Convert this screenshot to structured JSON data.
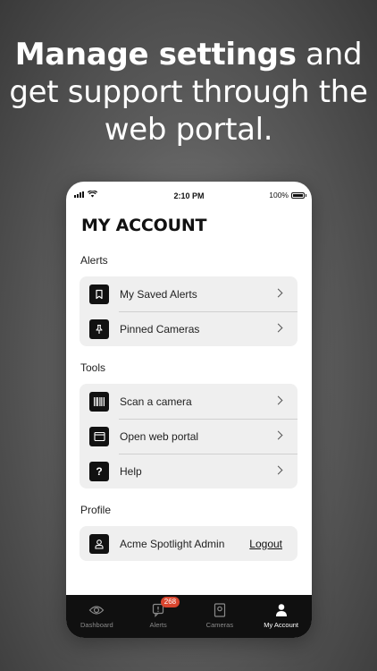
{
  "headline": {
    "bold": "Manage settings",
    "rest_1": "and",
    "line_2": "get support through the",
    "line_3": "web portal."
  },
  "status_bar": {
    "time": "2:10 PM",
    "battery": "100%"
  },
  "page_title": "MY ACCOUNT",
  "sections": {
    "alerts": {
      "label": "Alerts",
      "items": [
        {
          "label": "My Saved Alerts",
          "icon": "bookmark-icon"
        },
        {
          "label": "Pinned Cameras",
          "icon": "pin-icon"
        }
      ]
    },
    "tools": {
      "label": "Tools",
      "items": [
        {
          "label": "Scan a camera",
          "icon": "barcode-icon"
        },
        {
          "label": "Open web portal",
          "icon": "browser-window-icon"
        },
        {
          "label": "Help",
          "icon": "question-icon"
        }
      ]
    },
    "profile": {
      "label": "Profile",
      "user": "Acme Spotlight Admin",
      "logout": "Logout",
      "icon": "user-icon"
    }
  },
  "tabbar": {
    "tabs": [
      {
        "label": "Dashboard",
        "icon": "eye-icon"
      },
      {
        "label": "Alerts",
        "icon": "alert-icon",
        "badge": "268"
      },
      {
        "label": "Cameras",
        "icon": "camera-icon"
      },
      {
        "label": "My Account",
        "icon": "person-icon",
        "active": true
      }
    ]
  },
  "colors": {
    "badge": "#d8452e",
    "tabbar_bg": "#101010",
    "row_bg": "#efefef"
  }
}
